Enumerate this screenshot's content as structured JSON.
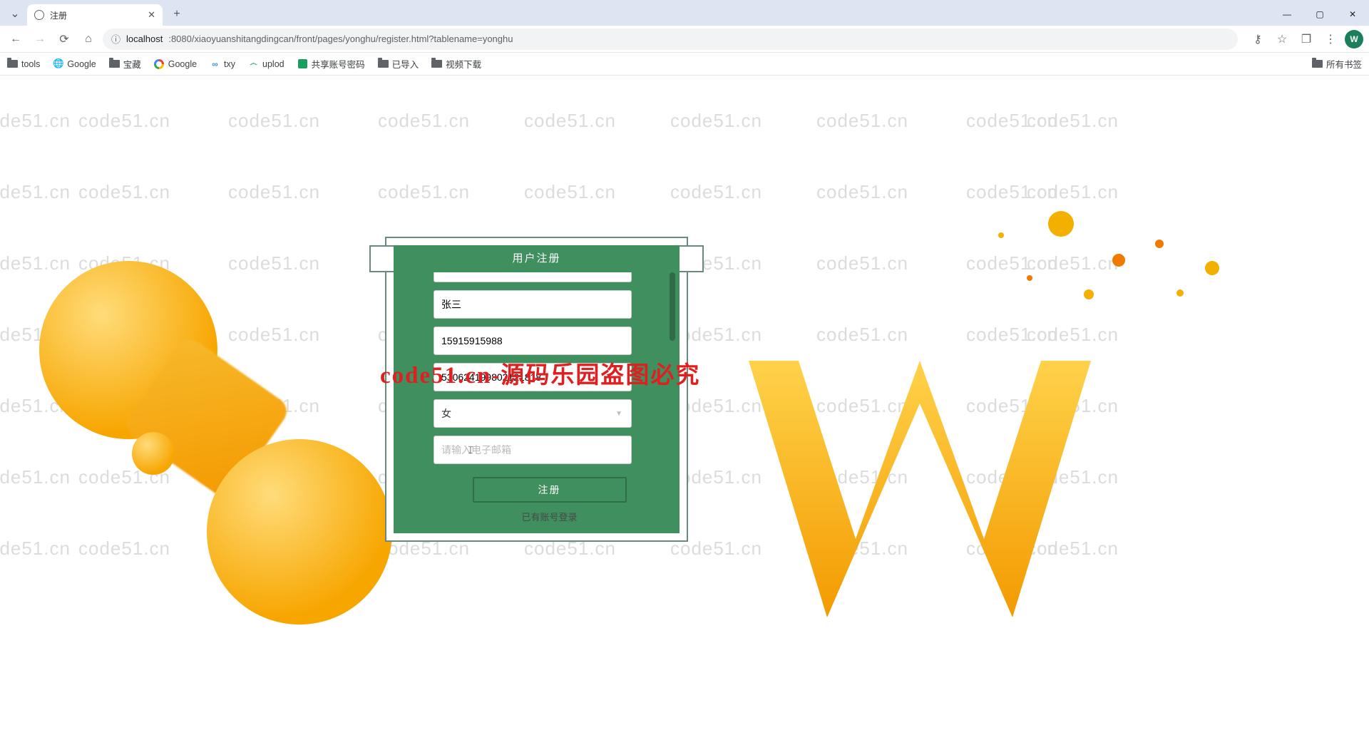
{
  "browser": {
    "tab_title": "注册",
    "new_tab_tooltip": "+",
    "window": {
      "min": "—",
      "max": "▢",
      "close": "✕"
    },
    "url": {
      "info_icon": "ⓘ",
      "host": "localhost",
      "rest": ":8080/xiaoyuanshitangdingcan/front/pages/yonghu/register.html?tablename=yonghu"
    },
    "right_icons": {
      "key": "⚷",
      "star": "☆",
      "ext": "❐",
      "menu": "⋮",
      "profile": "W"
    }
  },
  "bookmarks": {
    "items": [
      {
        "icon": "folder",
        "label": "tools"
      },
      {
        "icon": "globe",
        "label": "Google"
      },
      {
        "icon": "folder",
        "label": "宝藏"
      },
      {
        "icon": "g",
        "label": "Google"
      },
      {
        "icon": "txy",
        "label": "txy"
      },
      {
        "icon": "upl",
        "label": "uplod"
      },
      {
        "icon": "lock",
        "label": "共享账号密码"
      },
      {
        "icon": "folder",
        "label": "已导入"
      },
      {
        "icon": "folder",
        "label": "视频下载"
      }
    ],
    "right": {
      "icon": "folder",
      "label": "所有书签"
    }
  },
  "watermark_text": "code51.cn",
  "red_watermark": "code51.cn-源码乐园盗图必究",
  "form": {
    "title": "用户注册",
    "fields": {
      "name": {
        "value": "张三"
      },
      "phone": {
        "value": "15915915988"
      },
      "idcard": {
        "value": "530624199802121818"
      },
      "gender": {
        "value": "女"
      },
      "email": {
        "value": "",
        "placeholder": "请输入电子邮箱"
      }
    },
    "register_label": "注册",
    "login_link": "已有账号登录"
  }
}
